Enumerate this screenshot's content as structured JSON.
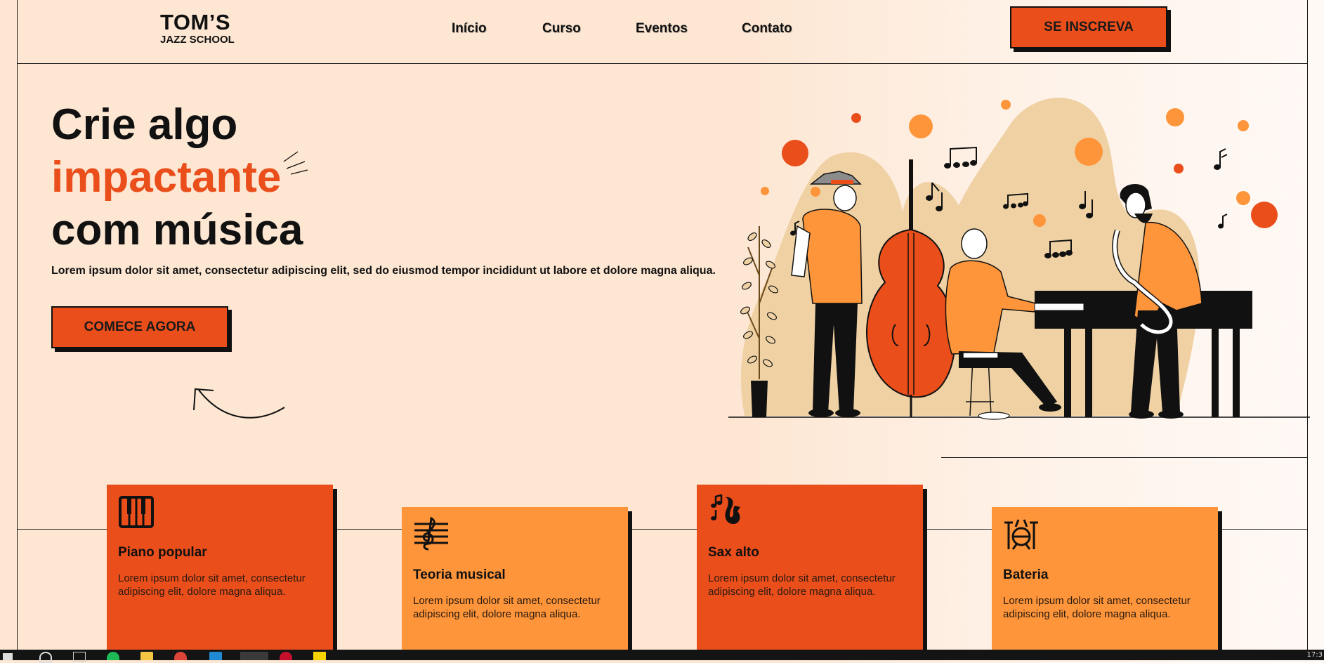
{
  "brand": {
    "line1": "TOM’S",
    "line2": "JAZZ SCHOOL"
  },
  "nav": {
    "items": [
      "Início",
      "Curso",
      "Eventos",
      "Contato"
    ]
  },
  "header": {
    "cta": "SE INSCREVA"
  },
  "hero": {
    "line1": "Crie algo",
    "line2": "impactante",
    "line3": "com música",
    "subtitle": "Lorem ipsum dolor sit amet, consectetur adipiscing elit, sed do eiusmod tempor incididunt ut labore et dolore magna aliqua.",
    "cta": "COMECE AGORA"
  },
  "courses": [
    {
      "title": "Piano popular",
      "desc": "Lorem ipsum dolor sit amet, consectetur adipiscing elit, dolore magna aliqua.",
      "icon": "piano-keys-icon"
    },
    {
      "title": "Teoria musical",
      "desc": "Lorem ipsum dolor sit amet, consectetur adipiscing elit, dolore magna aliqua.",
      "icon": "treble-clef-icon"
    },
    {
      "title": "Sax alto",
      "desc": "Lorem ipsum dolor sit amet, consectetur adipiscing elit, dolore magna aliqua.",
      "icon": "saxophone-icon"
    },
    {
      "title": "Bateria",
      "desc": "Lorem ipsum dolor sit amet, consectetur adipiscing elit, dolore magna aliqua.",
      "icon": "drum-kit-icon"
    }
  ],
  "colors": {
    "accent": "#ea4e1b",
    "accent_light": "#fe953a",
    "background": "#fde6d2",
    "ink": "#111111"
  },
  "taskbar": {
    "clock": "17:3"
  }
}
